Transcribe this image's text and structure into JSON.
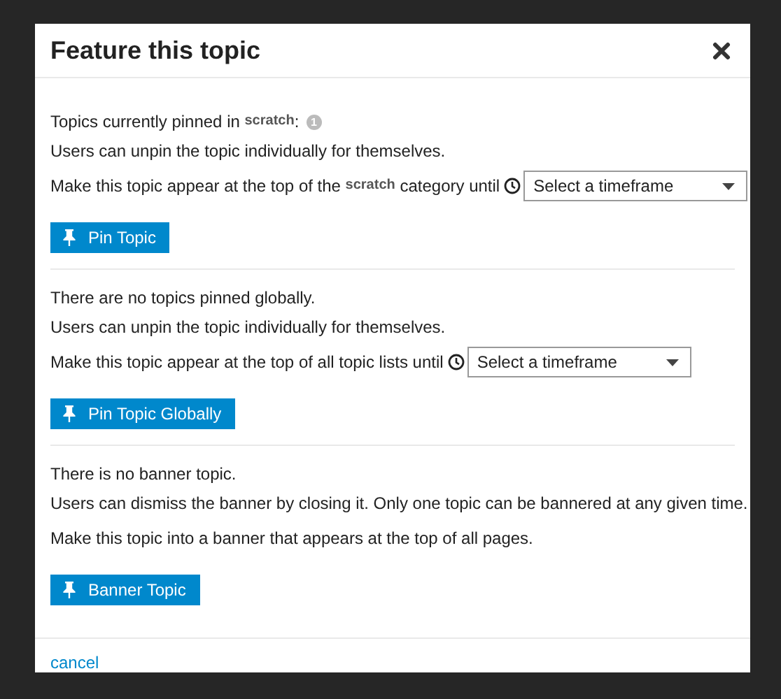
{
  "modal": {
    "title": "Feature this topic",
    "sections": [
      {
        "status": [
          {
            "kind": "text",
            "text": "Topics currently pinned in "
          },
          {
            "kind": "category",
            "text": "scratch"
          },
          {
            "kind": "text",
            "text": ":"
          },
          {
            "kind": "badge",
            "text": "1"
          }
        ],
        "note": "Users can unpin the topic individually for themselves.",
        "prompt": [
          {
            "kind": "text",
            "text": "Make this topic appear at the top of the "
          },
          {
            "kind": "category",
            "text": "scratch"
          },
          {
            "kind": "text",
            "text": " category until"
          }
        ],
        "select": {
          "placeholder": "Select a timeframe"
        },
        "button": "Pin Topic"
      },
      {
        "status": [
          {
            "kind": "text",
            "text": "There are no topics pinned globally."
          }
        ],
        "note": "Users can unpin the topic individually for themselves.",
        "prompt": [
          {
            "kind": "text",
            "text": "Make this topic appear at the top of all topic lists until"
          }
        ],
        "select": {
          "placeholder": "Select a timeframe"
        },
        "button": "Pin Topic Globally"
      },
      {
        "status": [
          {
            "kind": "text",
            "text": "There is no banner topic."
          }
        ],
        "note": "Users can dismiss the banner by closing it. Only one topic can be bannered at any given time.",
        "prompt": [
          {
            "kind": "text",
            "text": "Make this topic into a banner that appears at the top of all pages."
          }
        ],
        "button": "Banner Topic"
      }
    ],
    "cancel": "cancel"
  }
}
